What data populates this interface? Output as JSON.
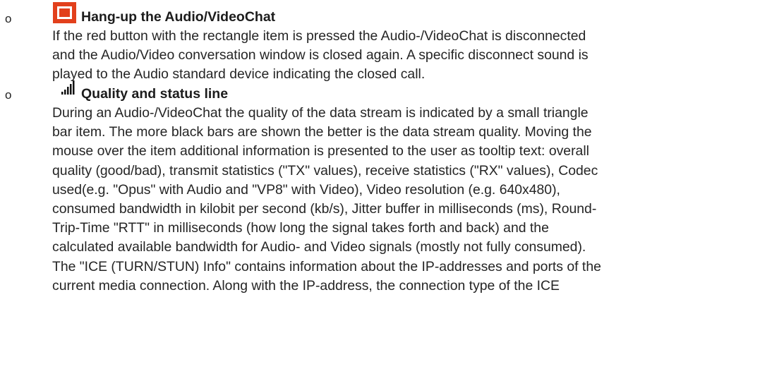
{
  "section_hangup": {
    "bullet": "o",
    "icon": "red-stop-square-icon",
    "title": "Hang-up the Audio/VideoChat",
    "lines": [
      "If the red button with the rectangle item is pressed the Audio-/VideoChat is disconnected",
      "and the Audio/Video conversation window is closed again. A specific disconnect sound is",
      "played to the Audio standard device indicating the closed call."
    ]
  },
  "section_quality": {
    "bullet": "o",
    "icon": "signal-bars-icon",
    "title": "Quality and status line",
    "lines": [
      "During an Audio-/VideoChat the quality of the data stream is indicated by a small triangle",
      "bar item. The more black bars are shown the better is the data stream quality. Moving the",
      "mouse over the item additional information is presented to the user as tooltip text: overall",
      "quality (good/bad), transmit statistics (\"TX\" values), receive statistics (\"RX\" values), Codec",
      "used(e.g. \"Opus\" with Audio and \"VP8\" with Video), Video resolution (e.g. 640x480),",
      "consumed bandwidth in kilobit per second (kb/s), Jitter buffer in milliseconds (ms), Round-",
      "Trip-Time \"RTT\" in milliseconds (how long the signal takes forth and back) and the",
      "calculated available bandwidth for Audio- and Video signals (mostly not fully consumed).",
      "The \"ICE (TURN/STUN) Info\" contains information about the IP-addresses and ports of the",
      "current media connection. Along with the IP-address, the connection type of the ICE"
    ]
  },
  "colors": {
    "stop_button_red": "#e2401c",
    "text": "#252525"
  }
}
